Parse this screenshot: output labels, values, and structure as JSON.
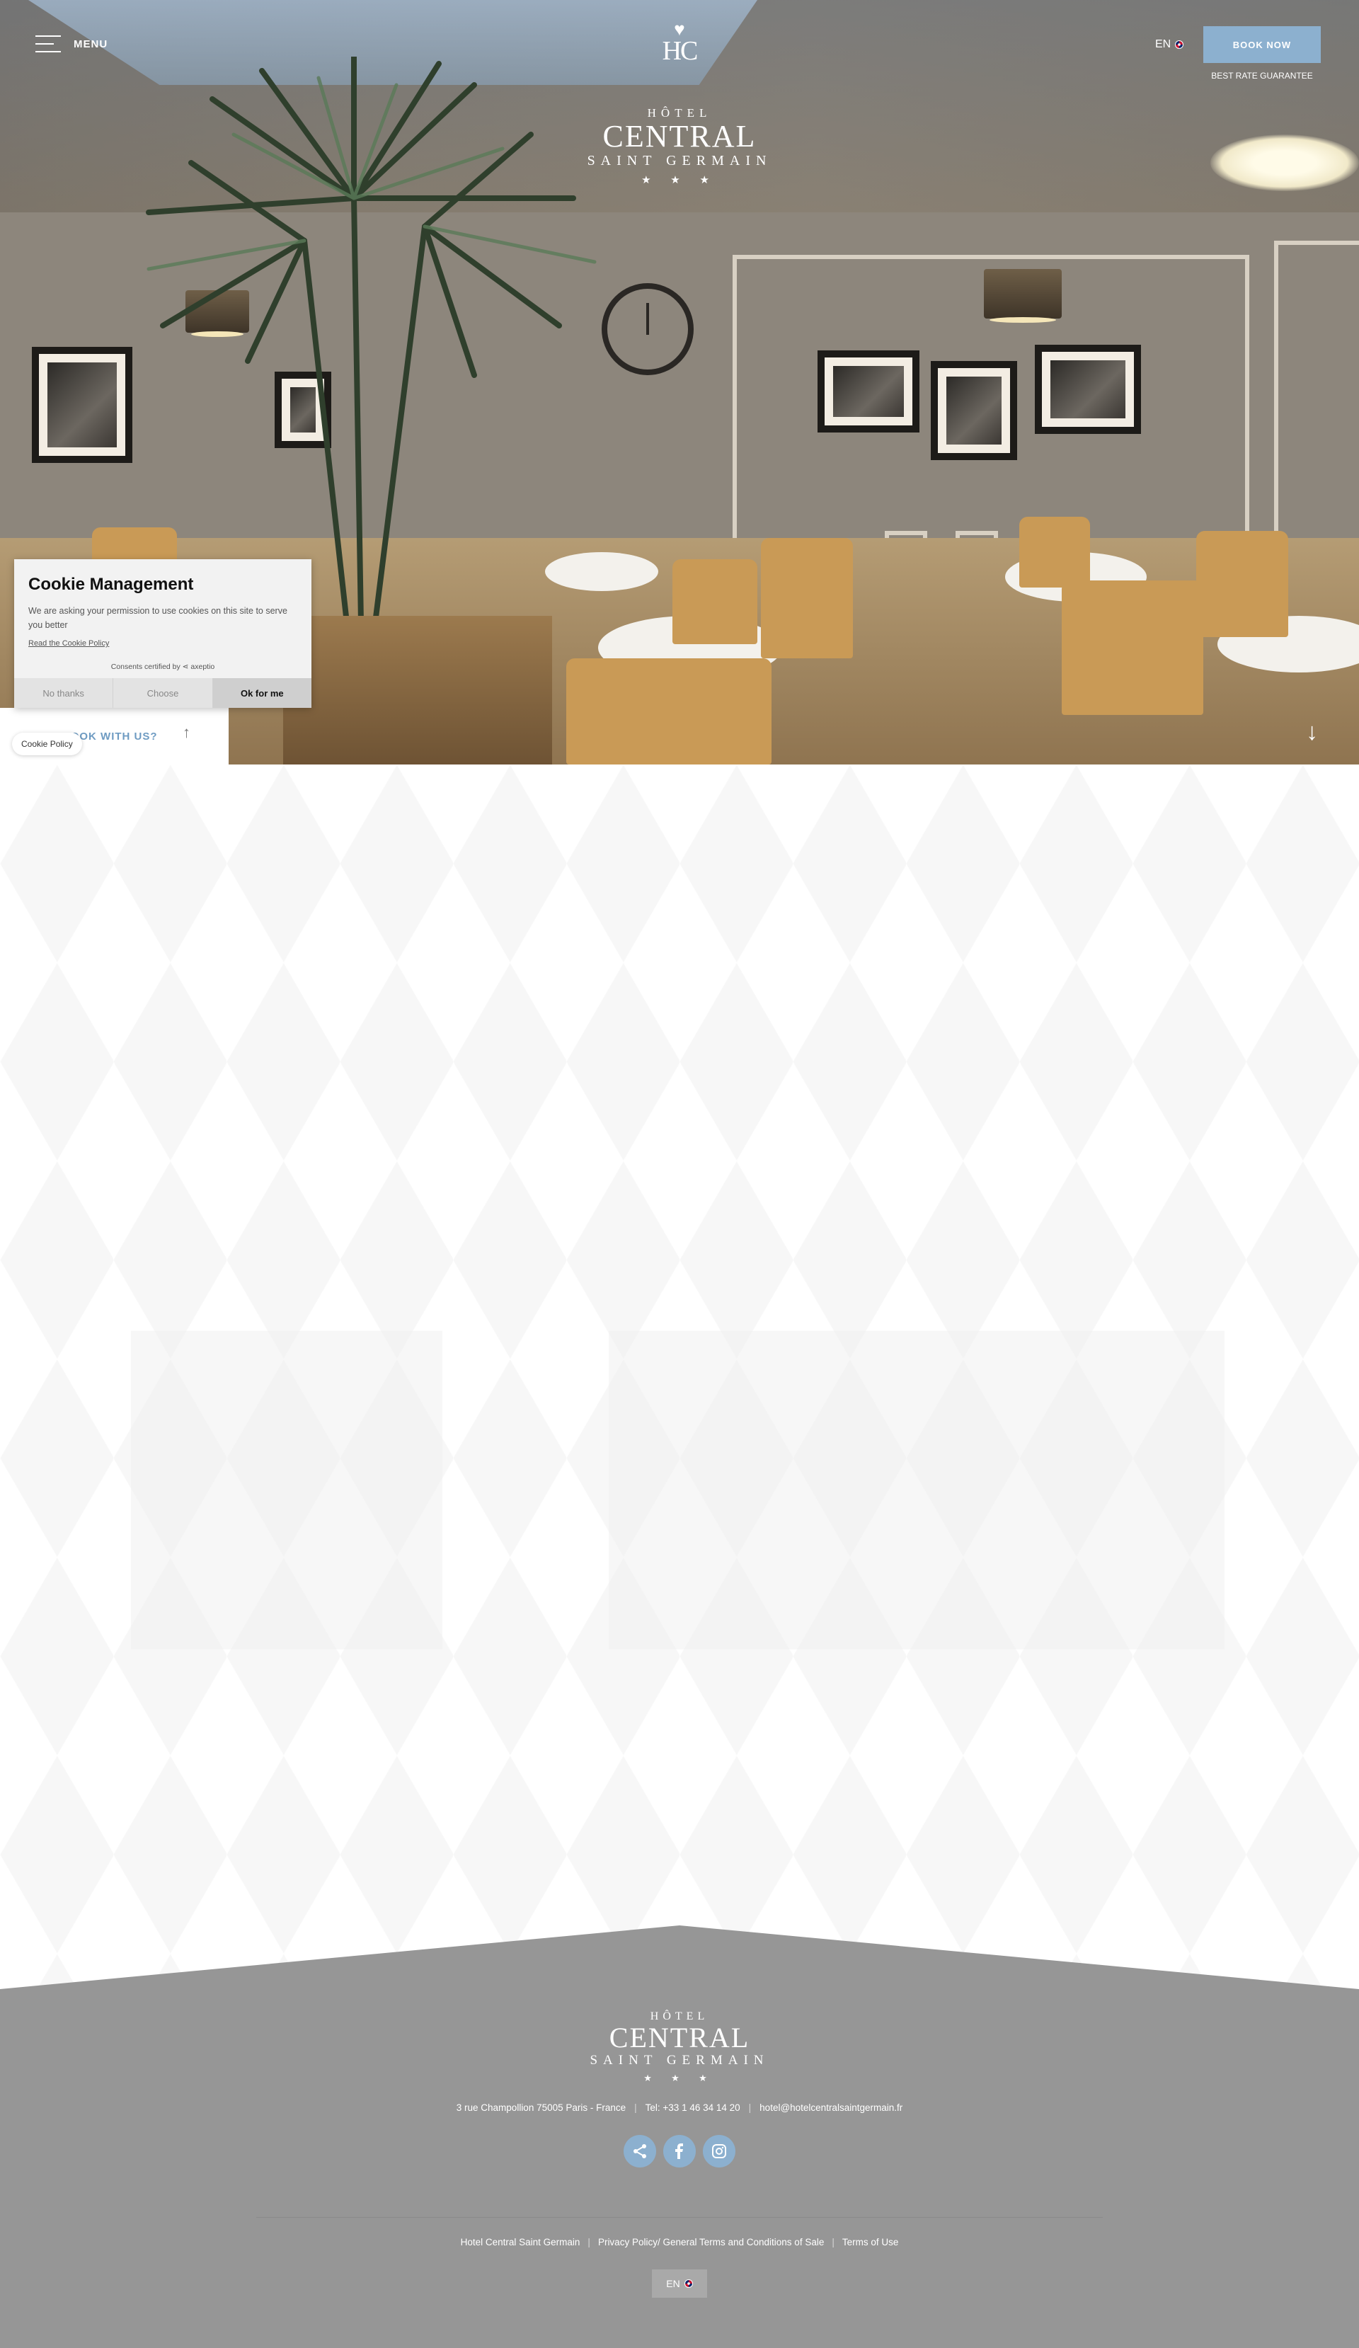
{
  "header": {
    "menu_label": "MENU",
    "language": "EN",
    "book_label": "BOOK NOW",
    "best_rate": "BEST RATE GUARANTEE"
  },
  "logo": {
    "monogram": "HC",
    "hotel": "HÔTEL",
    "central": "CENTRAL",
    "saint_germain": "SAINT GERMAIN",
    "stars": "★ ★ ★"
  },
  "cookie": {
    "title": "Cookie Management",
    "text": "We are asking your permission to use cookies on this site to serve you better",
    "link": "Read the Cookie Policy",
    "certified": "Consents certified by ⋖ axeptio",
    "no_thanks": "No thanks",
    "choose": "Choose",
    "ok": "Ok for me",
    "pill": "Cookie Policy"
  },
  "why_book": {
    "label": "WHY BOOK WITH US?",
    "arrow": "↑"
  },
  "scroll_arrow": "↓",
  "footer": {
    "hotel": "HÔTEL",
    "central": "CENTRAL",
    "saint_germain": "SAINT GERMAIN",
    "stars": "★ ★ ★",
    "address": "3 rue Champollion 75005 Paris - France",
    "tel": "Tel: +33 1 46 34 14 20",
    "email": "hotel@hotelcentralsaintgermain.fr",
    "links": [
      "Hotel Central Saint Germain",
      "Privacy Policy/ General Terms and Conditions of Sale",
      "Terms of Use"
    ],
    "language": "EN"
  },
  "colors": {
    "accent": "#8cb0cf",
    "footer_bg": "#969696"
  },
  "icons": [
    "menu-icon",
    "share-icon",
    "facebook-icon",
    "instagram-icon",
    "uk-flag-icon",
    "arrow-down-icon",
    "arrow-up-icon"
  ]
}
